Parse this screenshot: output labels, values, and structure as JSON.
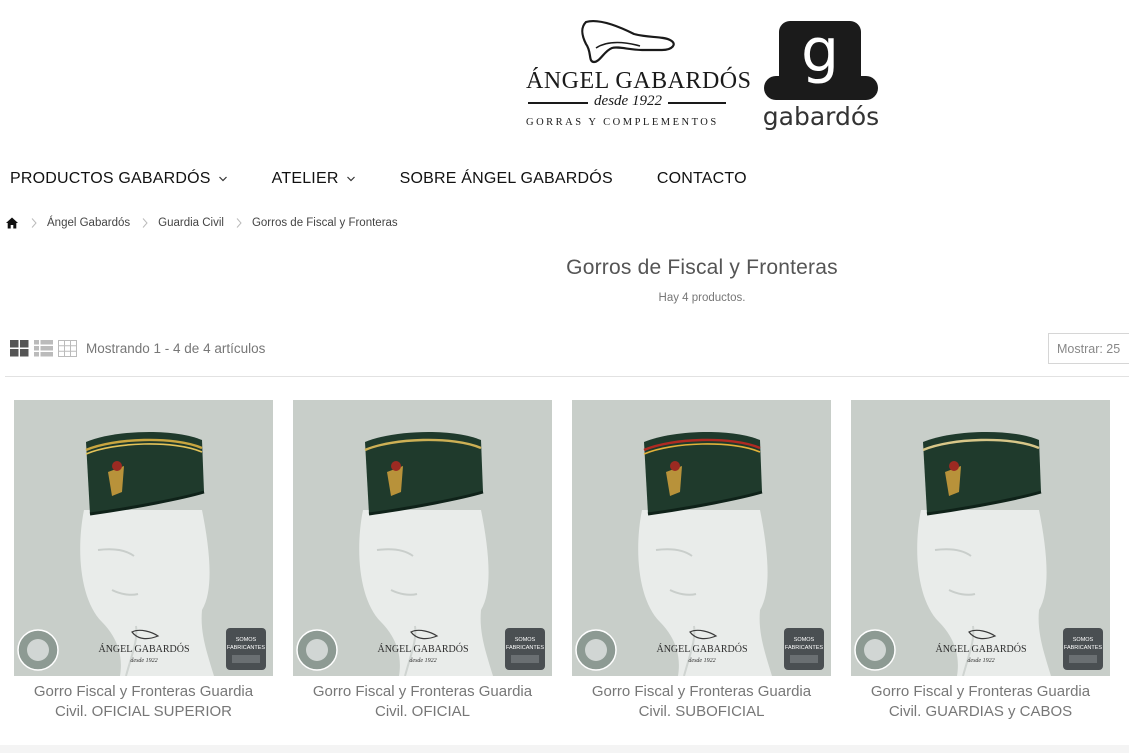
{
  "brand": {
    "name": "ÁNGEL GABARDÓS",
    "since": "desde 1922",
    "tagline": "GORRAS Y COMPLEMENTOS",
    "sub_logo_letter": "g",
    "sub_logo_text": "gabardós"
  },
  "nav": {
    "items": [
      {
        "label": "PRODUCTOS GABARDÓS",
        "has_dropdown": true
      },
      {
        "label": "ATELIER",
        "has_dropdown": true
      },
      {
        "label": "SOBRE ÁNGEL GABARDÓS",
        "has_dropdown": false
      },
      {
        "label": "CONTACTO",
        "has_dropdown": false
      }
    ]
  },
  "breadcrumb": {
    "icon": "home-icon",
    "items": [
      "Ángel Gabardós",
      "Guardia Civil",
      "Gorros de Fiscal y Fronteras"
    ]
  },
  "category": {
    "title": "Gorros de Fiscal y Fronteras",
    "count_text": "Hay 4 productos."
  },
  "toolbar": {
    "views": [
      "grid-view-icon",
      "list-view-icon",
      "table-view-icon"
    ],
    "showing_text": "Mostrando 1 - 4 de 4 artículos",
    "per_page_text": "Mostrar: 25"
  },
  "products": [
    {
      "name": "Gorro Fiscal y Fronteras Guardia Civil. OFICIAL SUPERIOR",
      "piping": "gold-double"
    },
    {
      "name": "Gorro Fiscal y Fronteras Guardia Civil. OFICIAL",
      "piping": "gold-single"
    },
    {
      "name": "Gorro Fiscal y Fronteras Guardia Civil. SUBOFICIAL",
      "piping": "red-gold"
    },
    {
      "name": "Gorro Fiscal y Fronteras Guardia Civil. GUARDIAS y CABOS",
      "piping": "pale-gold"
    }
  ],
  "product_image_watermark": {
    "brand": "ÁNGEL GABARDÓS",
    "since": "desde 1922",
    "badge_line1": "SOMOS",
    "badge_line2": "FABRICANTES"
  },
  "colors": {
    "cap_green": "#1f3a2c",
    "image_bg": "#c8cec9",
    "text_gray": "#777777"
  }
}
